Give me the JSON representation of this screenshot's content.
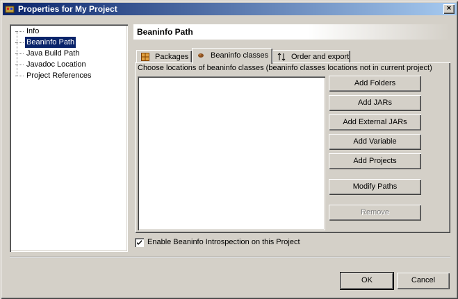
{
  "window": {
    "title": "Properties for My Project",
    "close_label": "×"
  },
  "tree": {
    "items": [
      {
        "label": "Info",
        "selected": false
      },
      {
        "label": "Beaninfo Path",
        "selected": true
      },
      {
        "label": "Java Build Path",
        "selected": false
      },
      {
        "label": "Javadoc Location",
        "selected": false
      },
      {
        "label": "Project References",
        "selected": false
      }
    ]
  },
  "header": {
    "title": "Beaninfo Path"
  },
  "tabs": [
    {
      "label": "Packages",
      "icon": "packages-icon",
      "active": false
    },
    {
      "label": "Beaninfo classes",
      "icon": "beaninfo-icon",
      "active": true
    },
    {
      "label": "Order and export",
      "icon": "order-arrows-icon",
      "active": false
    }
  ],
  "panel": {
    "description": "Choose locations of beaninfo classes (beaninfo classes locations not in current project)"
  },
  "buttons": {
    "add_folders": "Add Folders",
    "add_jars": "Add JARs",
    "add_external_jars": "Add External JARs",
    "add_variable": "Add Variable",
    "add_projects": "Add Projects",
    "modify_paths": "Modify Paths",
    "remove": "Remove"
  },
  "checkbox": {
    "label": "Enable Beaninfo Introspection on this Project",
    "checked": true
  },
  "footer": {
    "ok": "OK",
    "cancel": "Cancel"
  }
}
